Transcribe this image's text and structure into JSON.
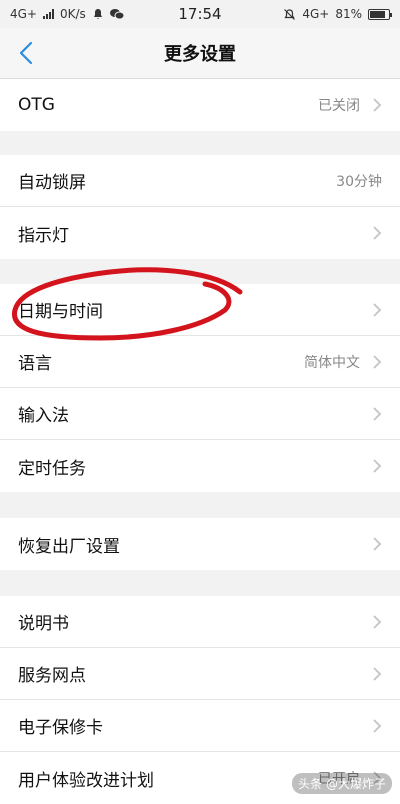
{
  "status_bar": {
    "network_left": "4G+",
    "speed": "0K/s",
    "time": "17:54",
    "network_right": "4G+",
    "battery": "81%",
    "battery_level": 0.81
  },
  "header": {
    "title": "更多设置"
  },
  "groups": [
    {
      "rows": [
        {
          "label": "OTG",
          "value": "已关闭"
        }
      ]
    },
    {
      "rows": [
        {
          "label": "自动锁屏",
          "value": "30分钟"
        },
        {
          "label": "指示灯",
          "value": ""
        }
      ]
    },
    {
      "rows": [
        {
          "label": "日期与时间",
          "value": ""
        },
        {
          "label": "语言",
          "value": "简体中文"
        },
        {
          "label": "输入法",
          "value": ""
        },
        {
          "label": "定时任务",
          "value": ""
        }
      ]
    },
    {
      "rows": [
        {
          "label": "恢复出厂设置",
          "value": ""
        }
      ]
    },
    {
      "rows": [
        {
          "label": "说明书",
          "value": ""
        },
        {
          "label": "服务网点",
          "value": ""
        },
        {
          "label": "电子保修卡",
          "value": ""
        },
        {
          "label": "用户体验改进计划",
          "value": "已开启"
        }
      ]
    }
  ],
  "watermark": "头条 @大爆炸子",
  "colors": {
    "accent": "#2a8de0",
    "annotation": "#d3141c"
  }
}
